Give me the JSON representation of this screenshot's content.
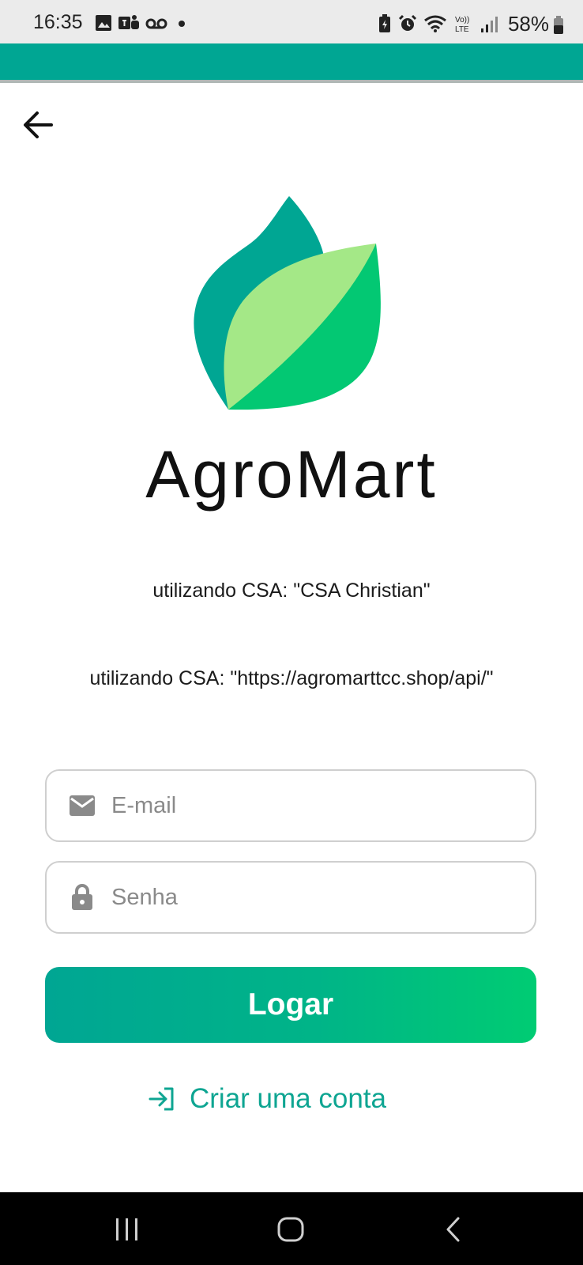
{
  "status_bar": {
    "time": "16:35",
    "battery": "58%",
    "left_icons": [
      "image-icon",
      "teams-icon",
      "voicemail-icon",
      "dot-icon"
    ],
    "right_icons": [
      "battery-saver-icon",
      "alarm-icon",
      "wifi-icon",
      "volte-icon",
      "signal-icon"
    ]
  },
  "app_bar": {
    "color": "#00a693"
  },
  "header": {
    "back_icon": "arrow-left-icon"
  },
  "brand": {
    "name": "AgroMart",
    "logo_colors": [
      "#00a693",
      "#a4e887",
      "#03c873"
    ]
  },
  "info": {
    "csa_name": "utilizando CSA: \"CSA Christian\"",
    "csa_url": "utilizando CSA: \"https://agromarttcc.shop/api/\""
  },
  "form": {
    "email": {
      "placeholder": "E-mail",
      "value": "",
      "icon": "mail-icon"
    },
    "password": {
      "placeholder": "Senha",
      "value": "",
      "icon": "lock-icon"
    },
    "login_label": "Logar",
    "create_account_label": "Criar uma conta",
    "create_account_icon": "login-arrow-icon",
    "accent": "#0ea592"
  },
  "nav_bar": {
    "buttons": [
      "recents-icon",
      "home-icon",
      "back-icon"
    ]
  }
}
